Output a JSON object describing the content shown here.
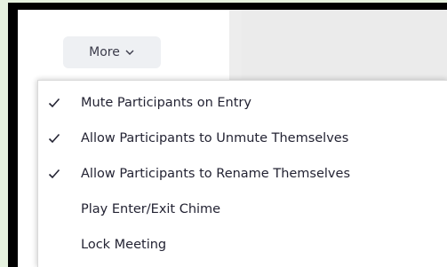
{
  "toolbar": {
    "more_label": "More"
  },
  "menu": {
    "items": [
      {
        "label": "Mute Participants on Entry",
        "checked": true
      },
      {
        "label": "Allow Participants to Unmute Themselves",
        "checked": true
      },
      {
        "label": "Allow Participants to Rename Themselves",
        "checked": true
      },
      {
        "label": "Play Enter/Exit Chime",
        "checked": false
      },
      {
        "label": "Lock Meeting",
        "checked": false
      }
    ]
  },
  "colors": {
    "menu_text": "#232333",
    "button_bg": "#eef0f3",
    "frame": "#000000",
    "outer_bg": "#e6f2df"
  },
  "icons": {
    "more_chevron": "chevron-down-icon",
    "check": "checkmark-icon"
  }
}
